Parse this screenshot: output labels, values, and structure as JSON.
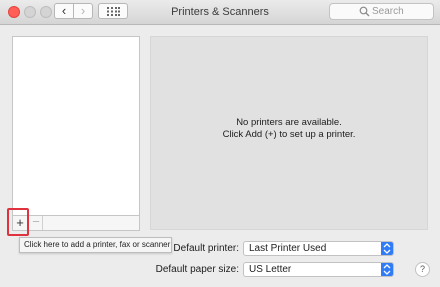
{
  "window": {
    "title": "Printers & Scanners",
    "back_glyph": "‹",
    "forward_glyph": "›"
  },
  "search": {
    "placeholder": "Search",
    "icon": "search-icon"
  },
  "printer_list": {
    "add_glyph": "+",
    "remove_glyph": "−",
    "tooltip": "Click here to add a printer, fax or scanner"
  },
  "detail": {
    "empty_line1": "No printers are available.",
    "empty_line2": "Click Add (+) to set up a printer."
  },
  "settings": {
    "default_printer_label": "Default printer:",
    "default_printer_value": "Last Printer Used",
    "paper_size_label": "Default paper size:",
    "paper_size_value": "US Letter",
    "help_glyph": "?"
  },
  "colors": {
    "close_light": "#ff5f57",
    "highlight": "#e0313f",
    "popup_accent": "#2f7cf6"
  }
}
